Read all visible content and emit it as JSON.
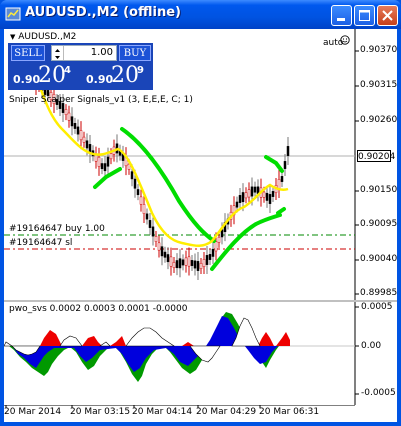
{
  "window": {
    "title": "AUDUSD.,M2 (offline)"
  },
  "chart": {
    "symbol_label": "AUDUSD.,M2",
    "auto_label": "auto",
    "indicator_title": "Sniper Scalper Signals_v1 (3, E,E,E, C; 1)",
    "price_labels": [
      "0.90370",
      "0.90315",
      "0.90260",
      "0.90204",
      "0.90150",
      "0.90095",
      "0.90040",
      "0.89985"
    ],
    "current_price": "0.90204",
    "orders": [
      {
        "label": "#19164647 buy 1.00",
        "color": "#008800"
      },
      {
        "label": "#19164647 sl",
        "color": "#cc0000"
      }
    ]
  },
  "trade_panel": {
    "sell_label": "SELL",
    "buy_label": "BUY",
    "lot_value": "1.00",
    "sell_quote": {
      "prefix": "0.90",
      "big": "20",
      "sup": "4"
    },
    "buy_quote": {
      "prefix": "0.90",
      "big": "20",
      "sup": "9"
    }
  },
  "oscillator": {
    "title": "pwo_svs 0.0002 0.0003 0.0001 -0.0000",
    "levels": [
      "0.0005",
      "0.00",
      "-0.0005"
    ]
  },
  "time_axis": [
    "20 Mar 2014",
    "20 Mar 03:15",
    "20 Mar 04:14",
    "20 Mar 04:29",
    "20 Mar 06:31"
  ],
  "colors": {
    "title_bar": "#0054e3",
    "band_green": "#00dd00",
    "ma_yellow": "#ffee00",
    "buy_line": "#008800",
    "sl_line": "#cc0000",
    "bull_candle": "#cc0000",
    "osc_blue": "#0000dd",
    "osc_red": "#ee0000",
    "osc_green": "#009900"
  },
  "icons": [
    "app-icon",
    "minimize-icon",
    "maximize-icon",
    "close-icon",
    "smiley-icon"
  ]
}
